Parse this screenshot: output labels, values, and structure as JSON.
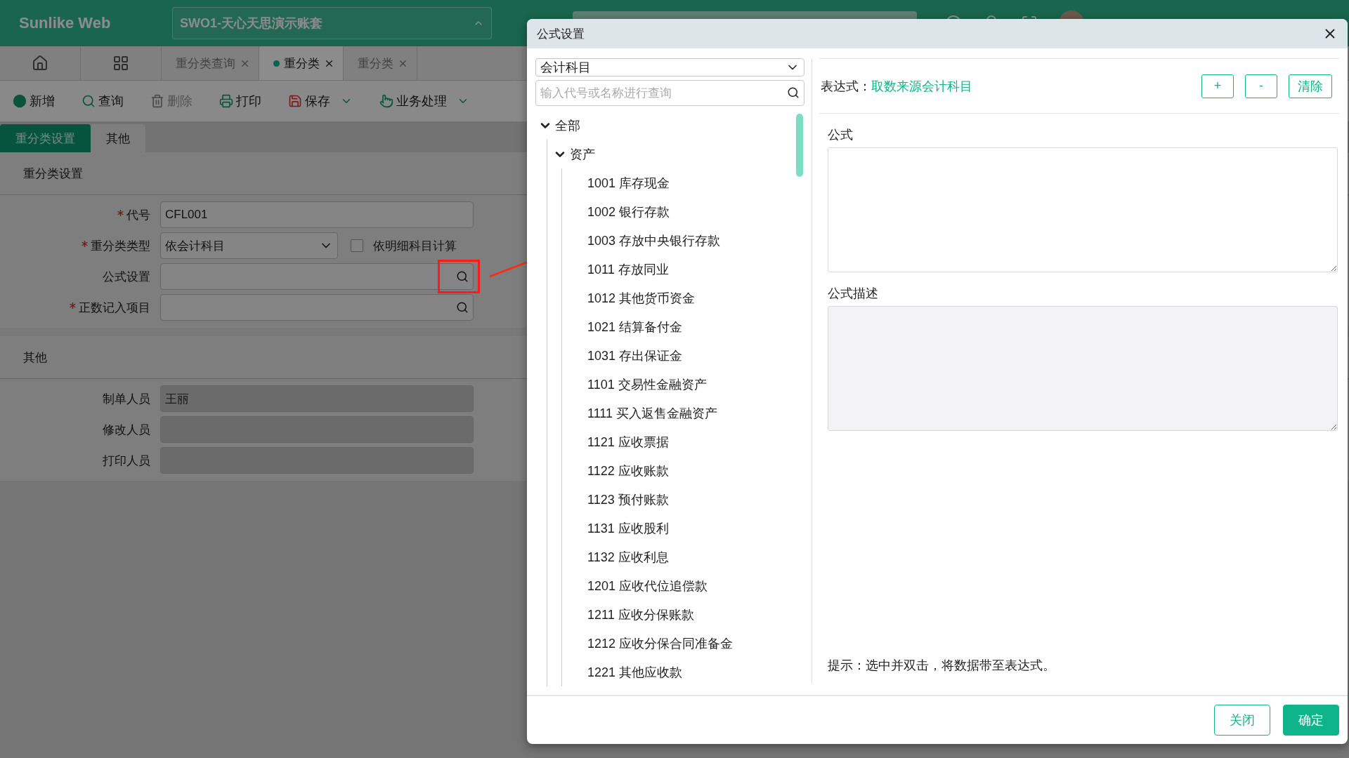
{
  "app": {
    "brand": "Sunlike Web",
    "account": "SWO1-天心天思演示账套"
  },
  "tabs": [
    {
      "label": "重分类查询",
      "selected": false,
      "dot": false
    },
    {
      "label": "重分类",
      "selected": true,
      "dot": true
    },
    {
      "label": "重分类",
      "selected": false,
      "dot": false
    }
  ],
  "toolbar": [
    {
      "label": "新增",
      "kind": "add",
      "disabled": false,
      "menu": false
    },
    {
      "label": "查询",
      "kind": "search",
      "disabled": false,
      "menu": false
    },
    {
      "label": "删除",
      "kind": "delete",
      "disabled": true,
      "menu": false
    },
    {
      "label": "打印",
      "kind": "print",
      "disabled": false,
      "menu": false
    },
    {
      "label": "保存",
      "kind": "save",
      "disabled": false,
      "menu": true
    },
    {
      "label": "业务处理",
      "kind": "process",
      "disabled": false,
      "menu": true
    }
  ],
  "form_tabs": [
    {
      "label": "重分类设置",
      "selected": true
    },
    {
      "label": "其他",
      "selected": false
    }
  ],
  "sections": [
    {
      "title": "重分类设置",
      "fields": [
        {
          "label": "代号",
          "required": true,
          "kind": "text",
          "value": "CFL001",
          "disabled": false
        },
        {
          "label": "重分类类型",
          "required": true,
          "kind": "select",
          "value": "依会计科目",
          "disabled": false,
          "checkbox": {
            "label": "依明细科目计算",
            "checked": false
          }
        },
        {
          "label": "公式设置",
          "required": false,
          "kind": "lookup",
          "disabled": false,
          "highlighted": true
        },
        {
          "label": "正数记入项目",
          "required": true,
          "kind": "lookup",
          "disabled": false,
          "highlighted": false
        }
      ]
    },
    {
      "title": "其他",
      "fields": [
        {
          "label": "制单人员",
          "required": false,
          "kind": "text",
          "value": "王丽",
          "disabled": true
        },
        {
          "label": "修改人员",
          "required": false,
          "kind": "text",
          "disabled": true
        },
        {
          "label": "打印人员",
          "required": false,
          "kind": "text",
          "disabled": true
        }
      ]
    }
  ],
  "dialog": {
    "title": "公式设置",
    "source_select": "会计科目",
    "search_placeholder": "输入代号或名称进行查询",
    "tree": [
      {
        "label": "全部",
        "expanded": true,
        "children": [
          {
            "label": "资产",
            "expanded": true,
            "children": [
              {
                "label": "1001 库存现金"
              },
              {
                "label": "1002 银行存款"
              },
              {
                "label": "1003 存放中央银行存款"
              },
              {
                "label": "1011 存放同业"
              },
              {
                "label": "1012 其他货币资金"
              },
              {
                "label": "1021 结算备付金"
              },
              {
                "label": "1031 存出保证金"
              },
              {
                "label": "1101 交易性金融资产"
              },
              {
                "label": "1111 买入返售金融资产"
              },
              {
                "label": "1121 应收票据"
              },
              {
                "label": "1122 应收账款"
              },
              {
                "label": "1123 预付账款"
              },
              {
                "label": "1131 应收股利"
              },
              {
                "label": "1132 应收利息"
              },
              {
                "label": "1201 应收代位追偿款"
              },
              {
                "label": "1211 应收分保账款"
              },
              {
                "label": "1212 应收分保合同准备金"
              },
              {
                "label": "1221 其他应收款"
              }
            ]
          }
        ]
      }
    ],
    "expression_label": "表达式：",
    "expression_value": "取数来源会计科目",
    "expression_buttons": [
      "+",
      "-",
      "清除"
    ],
    "formula": {
      "label": "公式",
      "disabled": false
    },
    "description": {
      "label": "公式描述",
      "disabled": true
    },
    "hint": "提示：选中并双击，将数据带至表达式。",
    "buttons": [
      {
        "label": "关闭",
        "kind": "secondary"
      },
      {
        "label": "确定",
        "kind": "primary"
      }
    ]
  }
}
